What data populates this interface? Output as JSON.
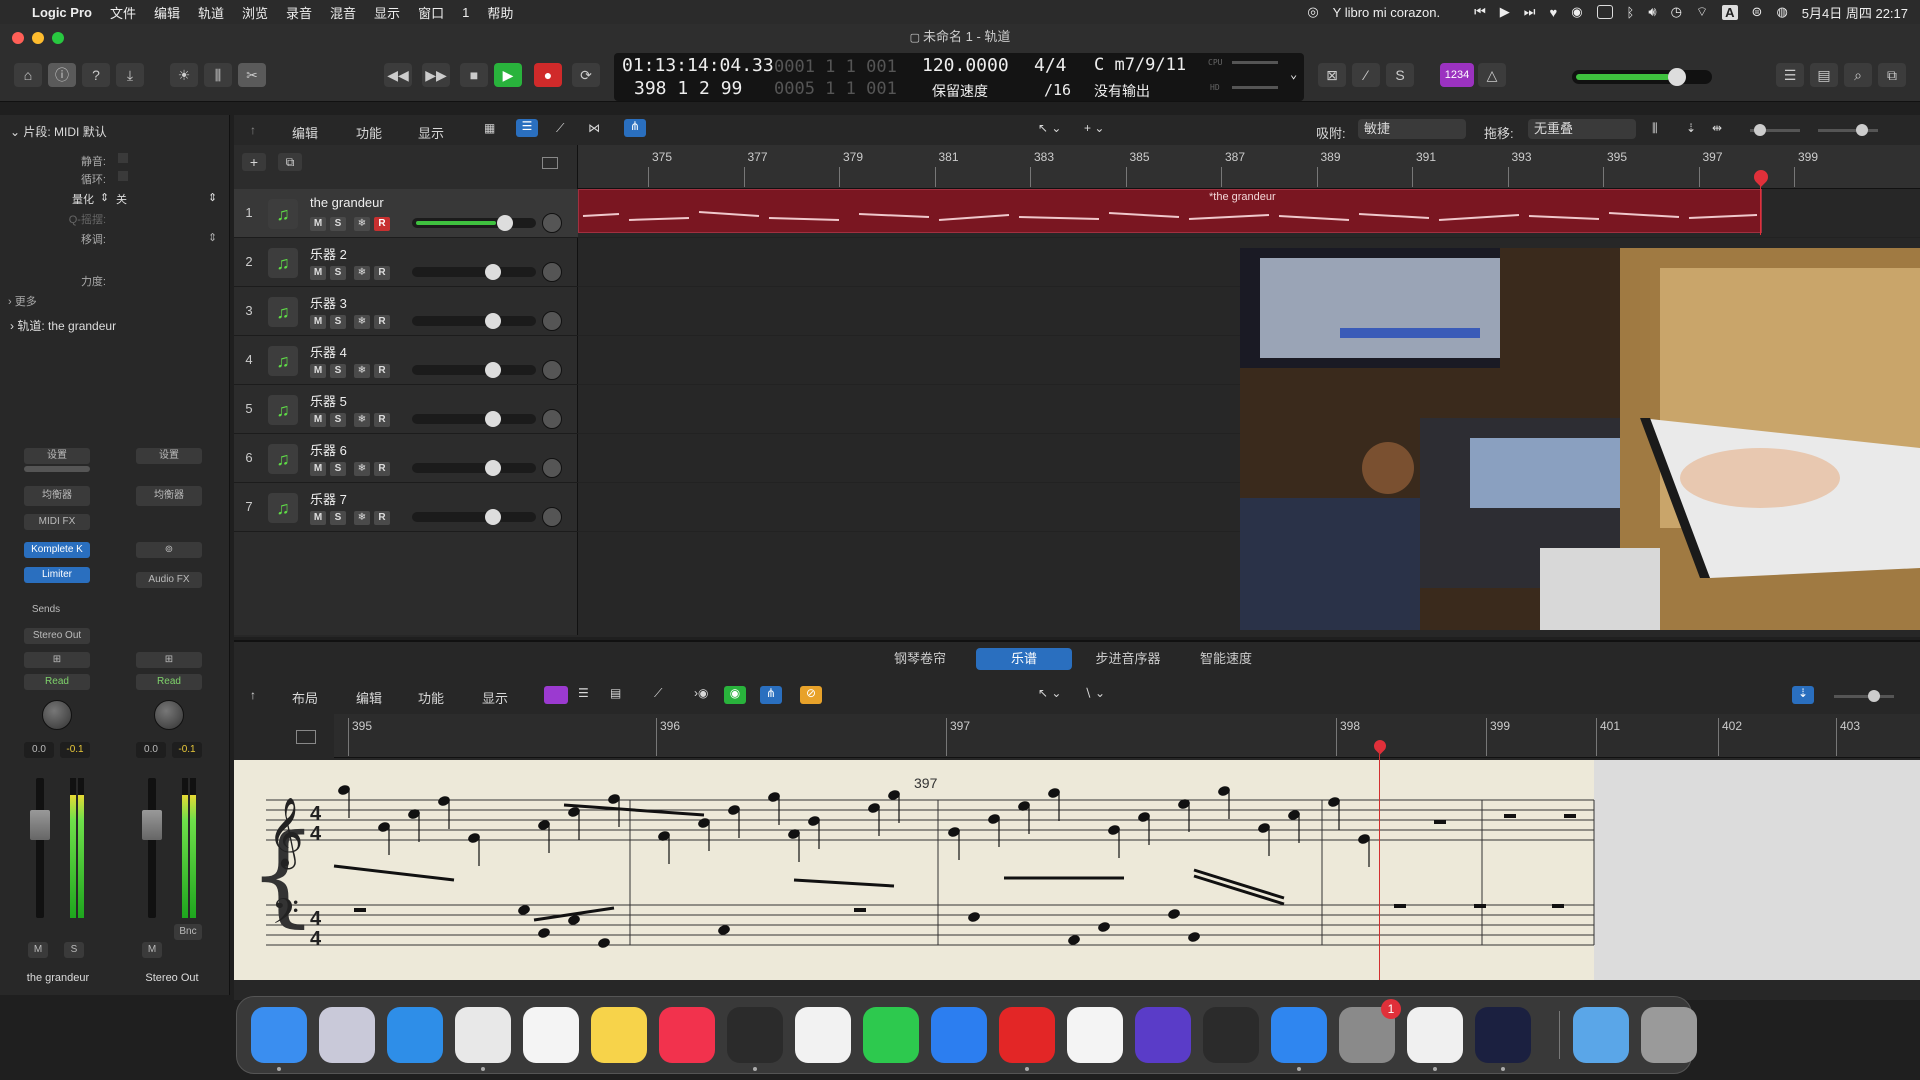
{
  "menubar": {
    "app": "Logic Pro",
    "items": [
      "文件",
      "编辑",
      "轨道",
      "浏览",
      "录音",
      "混音",
      "显示",
      "窗口",
      "1",
      "帮助"
    ],
    "now_playing": "Y libro mi corazon.",
    "date_time": "5月4日 周四 22:17",
    "input_source": "A"
  },
  "window": {
    "title": "未命名 1 - 轨道"
  },
  "lcd": {
    "time": "01:13:14:04.33",
    "bars": "398 1 2 99",
    "ghost_top": "0001 1 1 001",
    "ghost_bottom": "0005 1 1 001",
    "tempo": "120.0000",
    "tempo_label": "保留速度",
    "signature": "4/4",
    "division": "/16",
    "key": "C m7/9/11",
    "key_label": "没有输出",
    "cpu_label": "CPU",
    "hd_label": "HD",
    "badge": "1234"
  },
  "inspector": {
    "region_header": "片段: MIDI 默认",
    "mute_label": "静音:",
    "loop_label": "循环:",
    "quantize_label": "量化",
    "quantize_value": "关",
    "q_swing_label": "Q-摇摆:",
    "transpose_label": "移调:",
    "velocity_label": "力度:",
    "more_label": "更多",
    "track_header": "轨道: the grandeur",
    "strip1": {
      "setting": "设置",
      "eq": "均衡器",
      "midi_fx": "MIDI FX",
      "plugin1": "Komplete K",
      "plugin2": "Limiter",
      "sends": "Sends",
      "output": "Stereo Out",
      "automation": "Read",
      "vol": "0.0",
      "peak": "-0.1",
      "mute": "M",
      "solo": "S",
      "name": "the grandeur"
    },
    "strip2": {
      "setting": "设置",
      "eq": "均衡器",
      "audio_fx": "Audio FX",
      "automation": "Read",
      "vol": "0.0",
      "peak": "-0.1",
      "bounce": "Bnc",
      "mute": "M",
      "name": "Stereo Out"
    }
  },
  "tracks_toolbar": {
    "edit": "编辑",
    "functions": "功能",
    "view": "显示",
    "snap_label": "吸附:",
    "snap_value": "敏捷",
    "drag_label": "拖移:",
    "drag_value": "无重叠"
  },
  "ruler": [
    "375",
    "377",
    "379",
    "381",
    "383",
    "385",
    "387",
    "389",
    "391",
    "393",
    "395",
    "397",
    "399"
  ],
  "region_name": "*the grandeur",
  "tracks": [
    {
      "num": "1",
      "name": "the grandeur",
      "vol": 0.8,
      "selected": true
    },
    {
      "num": "2",
      "name": "乐器 2",
      "vol": 0.7
    },
    {
      "num": "3",
      "name": "乐器 3",
      "vol": 0.7
    },
    {
      "num": "4",
      "name": "乐器 4",
      "vol": 0.7
    },
    {
      "num": "5",
      "name": "乐器 5",
      "vol": 0.7
    },
    {
      "num": "6",
      "name": "乐器 6",
      "vol": 0.7
    },
    {
      "num": "7",
      "name": "乐器 7",
      "vol": 0.7
    }
  ],
  "track_buttons": {
    "m": "M",
    "s": "S",
    "r": "R"
  },
  "editor_tabs": [
    "钢琴卷帘",
    "乐谱",
    "步进音序器",
    "智能速度"
  ],
  "editor_toolbar": {
    "layout": "布局",
    "edit": "编辑",
    "functions": "功能",
    "view": "显示"
  },
  "score_ruler": [
    "395",
    "396",
    "397",
    "398",
    "399",
    "401",
    "402",
    "403"
  ],
  "score_bar_number": "397",
  "colors": {
    "accent": "#2a6fbf",
    "region": "#7a1621",
    "record": "#d02a2a",
    "play": "#29b33c",
    "score_bg": "#ede9d9"
  },
  "dock": [
    {
      "name": "finder-icon",
      "color": "#3a8ef0"
    },
    {
      "name": "launchpad-icon",
      "color": "#c9c9d9"
    },
    {
      "name": "safari-icon",
      "color": "#2e8ee8"
    },
    {
      "name": "chrome-icon",
      "color": "#e8e8e8"
    },
    {
      "name": "reminders-icon",
      "color": "#f4f4f4"
    },
    {
      "name": "notes-icon",
      "color": "#f7d34a"
    },
    {
      "name": "music-icon",
      "color": "#f2324d"
    },
    {
      "name": "logic-pro-icon",
      "color": "#2b2b2b"
    },
    {
      "name": "qq-icon",
      "color": "#f2f2f2"
    },
    {
      "name": "wechat-icon",
      "color": "#2dc94e"
    },
    {
      "name": "qq-browser-icon",
      "color": "#2c7ef0"
    },
    {
      "name": "netease-music-icon",
      "color": "#e32626"
    },
    {
      "name": "baidu-netdisk-icon",
      "color": "#f4f4f4"
    },
    {
      "name": "app-purple-icon",
      "color": "#5a3cc8"
    },
    {
      "name": "obs-icon",
      "color": "#2b2b2b"
    },
    {
      "name": "app-store-icon",
      "color": "#2f86f0"
    },
    {
      "name": "system-settings-icon",
      "color": "#8a8a8a"
    },
    {
      "name": "camera-app-icon",
      "color": "#f0f0f0"
    },
    {
      "name": "video-app-icon",
      "color": "#1b2040"
    },
    {
      "name": "downloads-icon",
      "color": "#5aa6e8"
    },
    {
      "name": "trash-icon",
      "color": "#9a9a9a"
    }
  ],
  "dock_badge": "1"
}
